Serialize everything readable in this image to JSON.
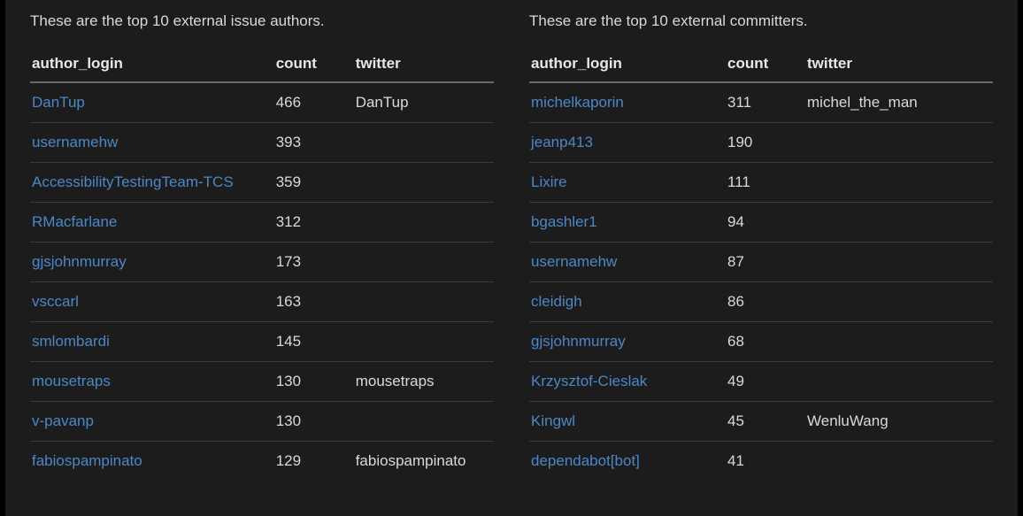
{
  "left": {
    "caption": "These are the top 10 external issue authors.",
    "headers": {
      "login": "author_login",
      "count": "count",
      "twitter": "twitter"
    },
    "rows": [
      {
        "login": "DanTup",
        "count": 466,
        "twitter": "DanTup"
      },
      {
        "login": "usernamehw",
        "count": 393,
        "twitter": ""
      },
      {
        "login": "AccessibilityTestingTeam-TCS",
        "count": 359,
        "twitter": ""
      },
      {
        "login": "RMacfarlane",
        "count": 312,
        "twitter": ""
      },
      {
        "login": "gjsjohnmurray",
        "count": 173,
        "twitter": ""
      },
      {
        "login": "vsccarl",
        "count": 163,
        "twitter": ""
      },
      {
        "login": "smlombardi",
        "count": 145,
        "twitter": ""
      },
      {
        "login": "mousetraps",
        "count": 130,
        "twitter": "mousetraps"
      },
      {
        "login": "v-pavanp",
        "count": 130,
        "twitter": ""
      },
      {
        "login": "fabiospampinato",
        "count": 129,
        "twitter": "fabiospampinato"
      }
    ]
  },
  "right": {
    "caption": "These are the top 10 external committers.",
    "headers": {
      "login": "author_login",
      "count": "count",
      "twitter": "twitter"
    },
    "rows": [
      {
        "login": "michelkaporin",
        "count": 311,
        "twitter": "michel_the_man"
      },
      {
        "login": "jeanp413",
        "count": 190,
        "twitter": ""
      },
      {
        "login": "Lixire",
        "count": 111,
        "twitter": ""
      },
      {
        "login": "bgashler1",
        "count": 94,
        "twitter": ""
      },
      {
        "login": "usernamehw",
        "count": 87,
        "twitter": ""
      },
      {
        "login": "cleidigh",
        "count": 86,
        "twitter": ""
      },
      {
        "login": "gjsjohnmurray",
        "count": 68,
        "twitter": ""
      },
      {
        "login": "Krzysztof-Cieslak",
        "count": 49,
        "twitter": ""
      },
      {
        "login": "Kingwl",
        "count": 45,
        "twitter": "WenluWang"
      },
      {
        "login": "dependabot[bot]",
        "count": 41,
        "twitter": ""
      }
    ]
  }
}
